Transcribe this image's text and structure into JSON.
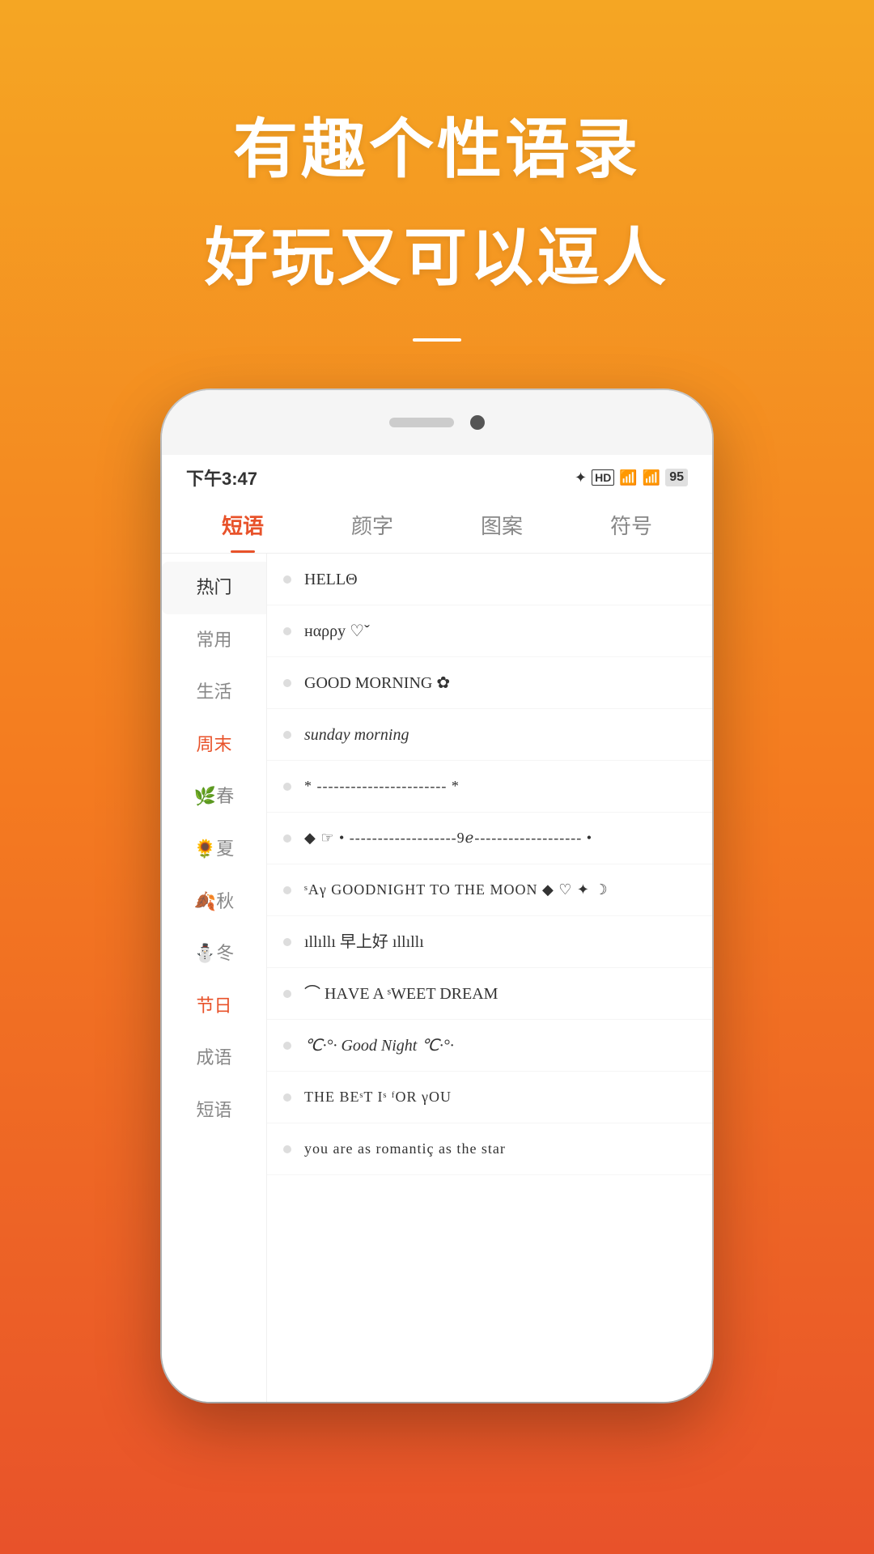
{
  "header": {
    "title1": "有趣个性语录",
    "title2": "好玩又可以逗人"
  },
  "status_bar": {
    "time": "下午3:47",
    "battery": "95"
  },
  "tabs": [
    {
      "label": "短语",
      "active": true
    },
    {
      "label": "颜字",
      "active": false
    },
    {
      "label": "图案",
      "active": false
    },
    {
      "label": "符号",
      "active": false
    }
  ],
  "sidebar": {
    "items": [
      {
        "label": "热门",
        "active": true,
        "highlight": false,
        "emoji": ""
      },
      {
        "label": "常用",
        "active": false,
        "highlight": false,
        "emoji": ""
      },
      {
        "label": "生活",
        "active": false,
        "highlight": false,
        "emoji": ""
      },
      {
        "label": "周末",
        "active": false,
        "highlight": true,
        "emoji": ""
      },
      {
        "label": "🌿春",
        "active": false,
        "highlight": false,
        "emoji": "🌿"
      },
      {
        "label": "🌻夏",
        "active": false,
        "highlight": false,
        "emoji": "🌻"
      },
      {
        "label": "🍂秋",
        "active": false,
        "highlight": false,
        "emoji": "🍂"
      },
      {
        "label": "⛄冬",
        "active": false,
        "highlight": false,
        "emoji": "⛄"
      },
      {
        "label": "节日",
        "active": false,
        "highlight": true,
        "emoji": ""
      },
      {
        "label": "成语",
        "active": false,
        "highlight": false,
        "emoji": ""
      },
      {
        "label": "短语",
        "active": false,
        "highlight": false,
        "emoji": ""
      }
    ]
  },
  "list_items": [
    {
      "text": "HELLΘ"
    },
    {
      "text": "нαρρу ♡ˇ"
    },
    {
      "text": "GOOD MORNING ✿"
    },
    {
      "text": "sunday morning"
    },
    {
      "text": "* ----------------------- *"
    },
    {
      "text": "◆ ☞ • -------------------9ℯ------------------- •"
    },
    {
      "text": "ˢAγ GOODNIGHT TO THE MOON ◆ ♡ ✦ ☽"
    },
    {
      "text": "ıllıllı 早上好 ıllıllı"
    },
    {
      "text": "⌒ HАVE A ˢWEET DREAM"
    },
    {
      "text": "℃·°· Good Night ℃·°·"
    },
    {
      "text": "THE  BEˢT  Iˢ  ᶠOR  γOU"
    },
    {
      "text": "you are as romantiç as the star"
    }
  ]
}
